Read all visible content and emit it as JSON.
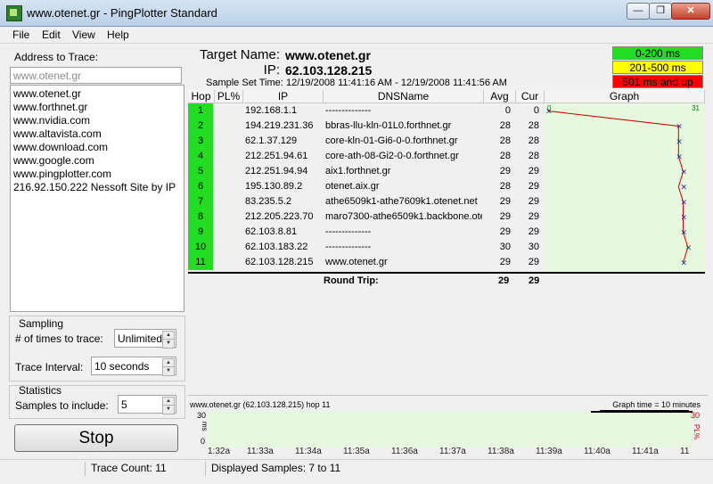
{
  "window": {
    "title": "www.otenet.gr - PingPlotter Standard",
    "min_glyph": "—",
    "max_glyph": "❐",
    "close_glyph": "✕"
  },
  "menu": [
    "File",
    "Edit",
    "View",
    "Help"
  ],
  "left": {
    "address_label": "Address to Trace:",
    "address_value": "www.otenet.gr",
    "history": [
      "www.otenet.gr",
      "www.forthnet.gr",
      "www.nvidia.com",
      "www.altavista.com",
      "www.download.com",
      "www.google.com",
      "www.pingplotter.com",
      "216.92.150.222 Nessoft Site by IP"
    ],
    "sampling_label": "Sampling",
    "times_label": "# of times to trace:",
    "times_value": "Unlimited",
    "interval_label": "Trace Interval:",
    "interval_value": "10 seconds",
    "statistics_label": "Statistics",
    "samples_label": "Samples to include:",
    "samples_value": "5",
    "stop_label": "Stop"
  },
  "header": {
    "target_label": "Target Name:",
    "target_value": "www.otenet.gr",
    "ip_label": "IP:",
    "ip_value": "62.103.128.215",
    "sample_time_label": "Sample Set Time:",
    "sample_time_value": "12/19/2008 11:41:16 AM - 12/19/2008 11:41:56 AM"
  },
  "legend": [
    {
      "label": "0-200 ms",
      "color": "#22dd22",
      "text_color": "#000000"
    },
    {
      "label": "201-500 ms",
      "color": "#ffff00",
      "text_color": "#000000"
    },
    {
      "label": "501 ms and up",
      "color": "#ff0000",
      "text_color": "#000000"
    }
  ],
  "table": {
    "columns": [
      "Hop",
      "PL%",
      "IP",
      "DNSName",
      "Avg",
      "Cur",
      "Graph"
    ],
    "graph_scale_left": "0",
    "graph_scale_right": "31",
    "rows": [
      {
        "hop": "1",
        "pl": "",
        "ip": "192.168.1.1",
        "dns": "--------------",
        "avg": "0",
        "cur": "0"
      },
      {
        "hop": "2",
        "pl": "",
        "ip": "194.219.231.36",
        "dns": "bbras-llu-kln-01L0.forthnet.gr",
        "avg": "28",
        "cur": "28"
      },
      {
        "hop": "3",
        "pl": "",
        "ip": "62.1.37.129",
        "dns": "core-kln-01-Gi6-0-0.forthnet.gr",
        "avg": "28",
        "cur": "28"
      },
      {
        "hop": "4",
        "pl": "",
        "ip": "212.251.94.61",
        "dns": "core-ath-08-Gi2-0-0.forthnet.gr",
        "avg": "28",
        "cur": "28"
      },
      {
        "hop": "5",
        "pl": "",
        "ip": "212.251.94.94",
        "dns": "aix1.forthnet.gr",
        "avg": "29",
        "cur": "29"
      },
      {
        "hop": "6",
        "pl": "",
        "ip": "195.130.89.2",
        "dns": "otenet.aix.gr",
        "avg": "28",
        "cur": "29"
      },
      {
        "hop": "7",
        "pl": "",
        "ip": "83.235.5.2",
        "dns": "athe6509k1-athe7609k1.otenet.net",
        "avg": "29",
        "cur": "29"
      },
      {
        "hop": "8",
        "pl": "",
        "ip": "212.205.223.70",
        "dns": "maro7300-athe6509k1.backbone.otenet.net",
        "avg": "29",
        "cur": "29"
      },
      {
        "hop": "9",
        "pl": "",
        "ip": "62.103.8.81",
        "dns": "--------------",
        "avg": "29",
        "cur": "29"
      },
      {
        "hop": "10",
        "pl": "",
        "ip": "62.103.183.22",
        "dns": "--------------",
        "avg": "30",
        "cur": "30"
      },
      {
        "hop": "11",
        "pl": "",
        "ip": "62.103.128.215",
        "dns": "www.otenet.gr",
        "avg": "29",
        "cur": "29"
      }
    ],
    "round_trip_label": "Round Trip:",
    "round_trip_avg": "29",
    "round_trip_cur": "29"
  },
  "bottom_graph": {
    "caption": "www.otenet.gr (62.103.128.215) hop 11",
    "graph_time": "Graph time = 10 minutes",
    "y_top": "30",
    "y_bottom": "0",
    "y_unit": "ms",
    "right_top": "30",
    "right_unit": "PL%",
    "time_labels": [
      "1:32a",
      "11:33a",
      "11:34a",
      "11:35a",
      "11:36a",
      "11:37a",
      "11:38a",
      "11:39a",
      "11:40a",
      "11:41a",
      "11"
    ]
  },
  "status": {
    "trace_count": "Trace Count: 11",
    "displayed_samples": "Displayed Samples: 7 to 11"
  }
}
